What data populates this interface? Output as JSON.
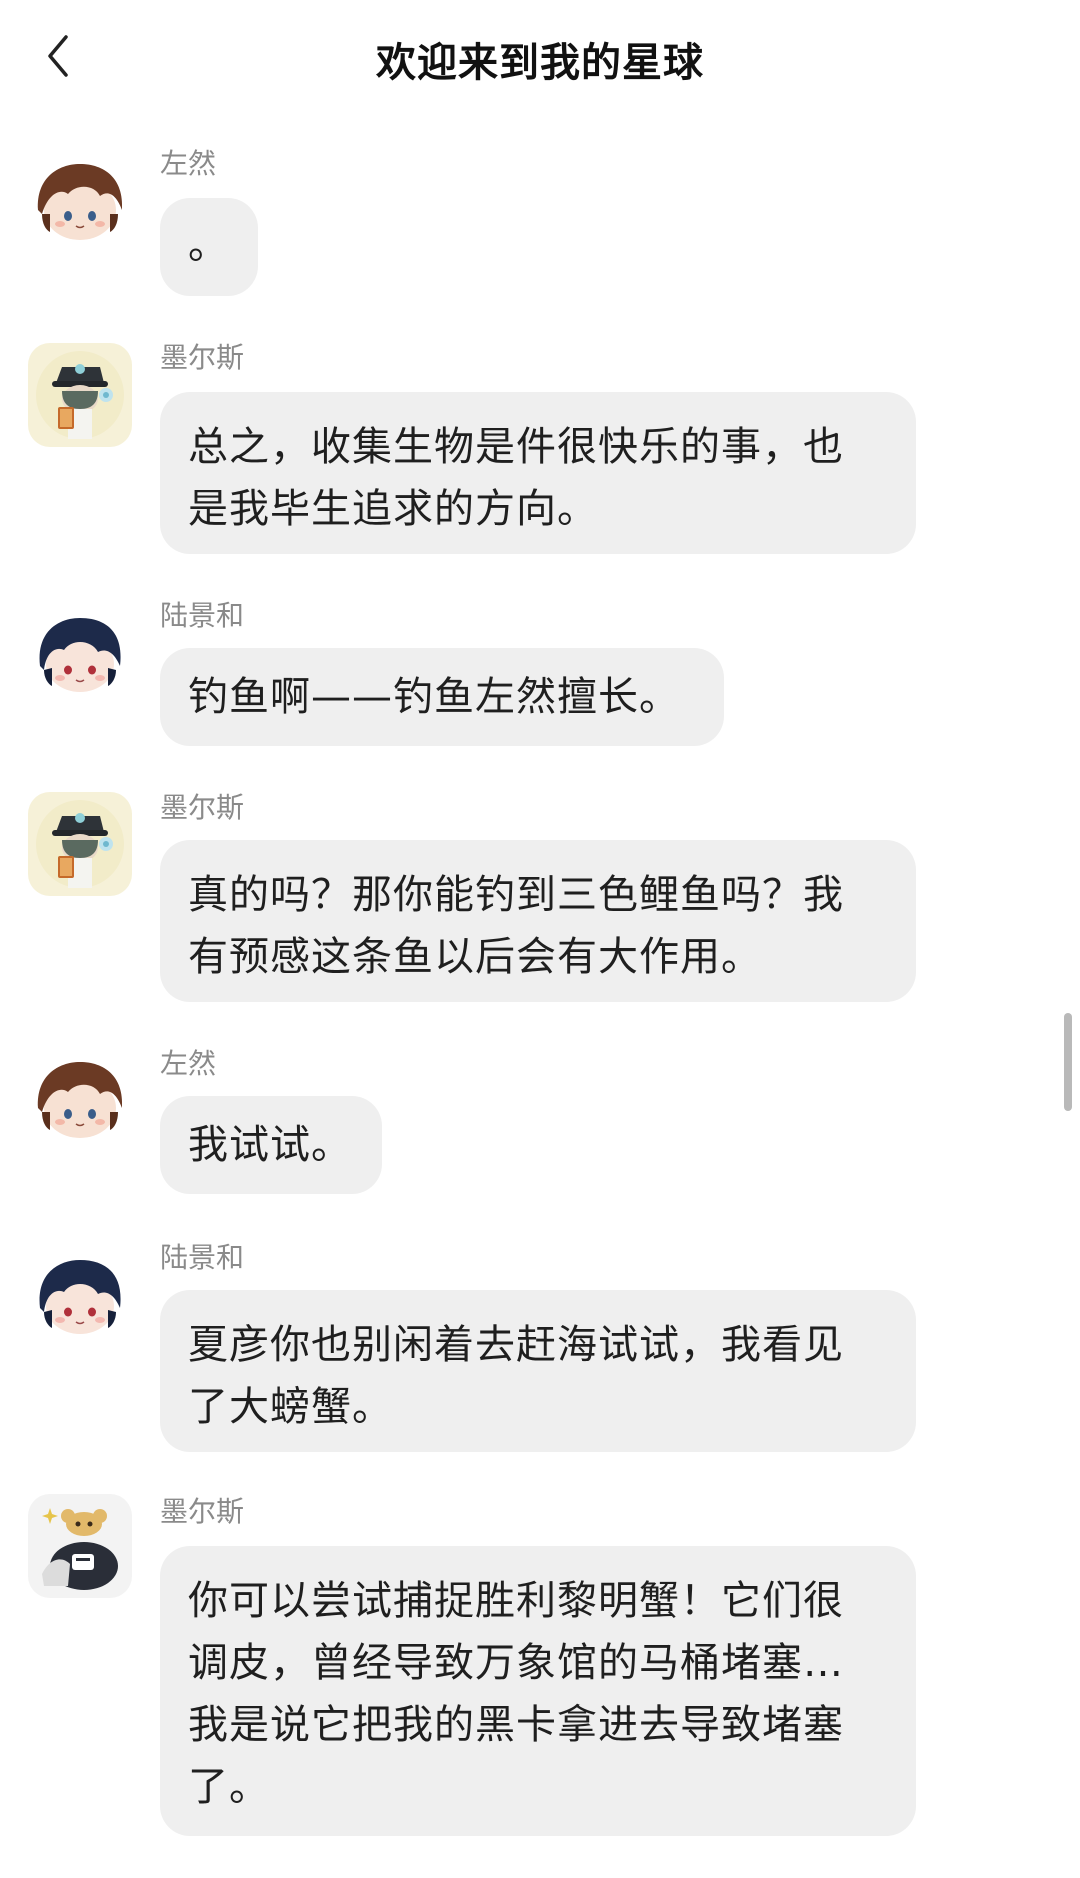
{
  "header": {
    "title": "欢迎来到我的星球",
    "back_icon": "chevron-left-icon"
  },
  "messages": [
    {
      "sender": "左然",
      "text": "。"
    },
    {
      "sender": "墨尔斯",
      "text": "总之，收集生物是件很快乐的事，也\n是我毕生追求的方向。"
    },
    {
      "sender": "陆景和",
      "text": "钓鱼啊——钓鱼左然擅长。"
    },
    {
      "sender": "墨尔斯",
      "text": "真的吗？那你能钓到三色鲤鱼吗？我\n有预感这条鱼以后会有大作用。"
    },
    {
      "sender": "左然",
      "text": "我试试。"
    },
    {
      "sender": "陆景和",
      "text": "夏彦你也别闲着去赶海试试，我看见\n了大螃蟹。"
    },
    {
      "sender": "墨尔斯",
      "text": "你可以尝试捕捉胜利黎明蟹！它们很\n调皮，曾经导致万象馆的马桶堵塞…\n我是说它把我的黑卡拿进去导致堵塞\n了。"
    }
  ],
  "colors": {
    "bubble_bg": "#efefef",
    "name_text": "#8a8a8a",
    "title_text": "#111111"
  }
}
